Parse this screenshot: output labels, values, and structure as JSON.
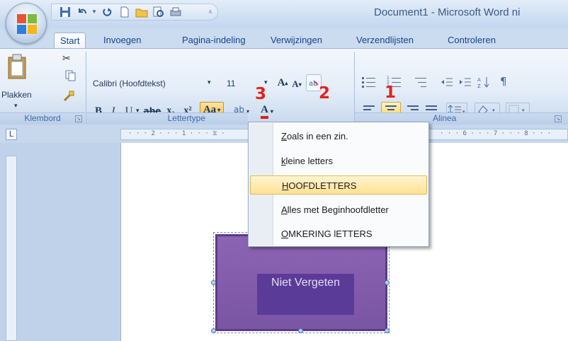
{
  "title": "Document1 - Microsoft Word ni",
  "tabs": [
    "Start",
    "Invoegen",
    "Pagina-indeling",
    "Verwijzingen",
    "Verzendlijsten",
    "Controleren"
  ],
  "clipboard": {
    "paste_label": "Plakken",
    "group_label": "Klembord"
  },
  "font": {
    "name": "Calibri (Hoofdtekst)",
    "size": "11",
    "group_label": "Lettertype",
    "bold": "B",
    "italic": "I",
    "underline": "U",
    "strike": "abe",
    "sub": "x₂",
    "sup": "x²",
    "change_case": "Aa",
    "grow": "A",
    "shrink": "A",
    "highlight": "ab",
    "color": "A"
  },
  "paragraph": {
    "group_label": "Alinea"
  },
  "markers": {
    "one": "1",
    "two": "2",
    "three": "3"
  },
  "ruler_text": "· · · 2 · · · 1 · · · ⧖ ·",
  "ruler_right_text": "· · · 6 · · · 7 · · · 8 · · ·",
  "ruler_corner": "L",
  "menu": {
    "items": [
      {
        "accel": "Z",
        "rest": "oals in een zin."
      },
      {
        "accel": "k",
        "rest": "leine letters"
      },
      {
        "accel": "H",
        "rest": "OOFDLETTERS"
      },
      {
        "accel": "A",
        "rest": "lles met Beginhoofdletter"
      },
      {
        "accel": "O",
        "rest": "MKERING lETTERS"
      }
    ],
    "highlighted_index": 2
  },
  "shape_text": "Niet Vergeten",
  "colors": {
    "accent_highlight": "#ffd466",
    "marker_red": "#e1251b",
    "shape_fill": "#7a55a4"
  }
}
